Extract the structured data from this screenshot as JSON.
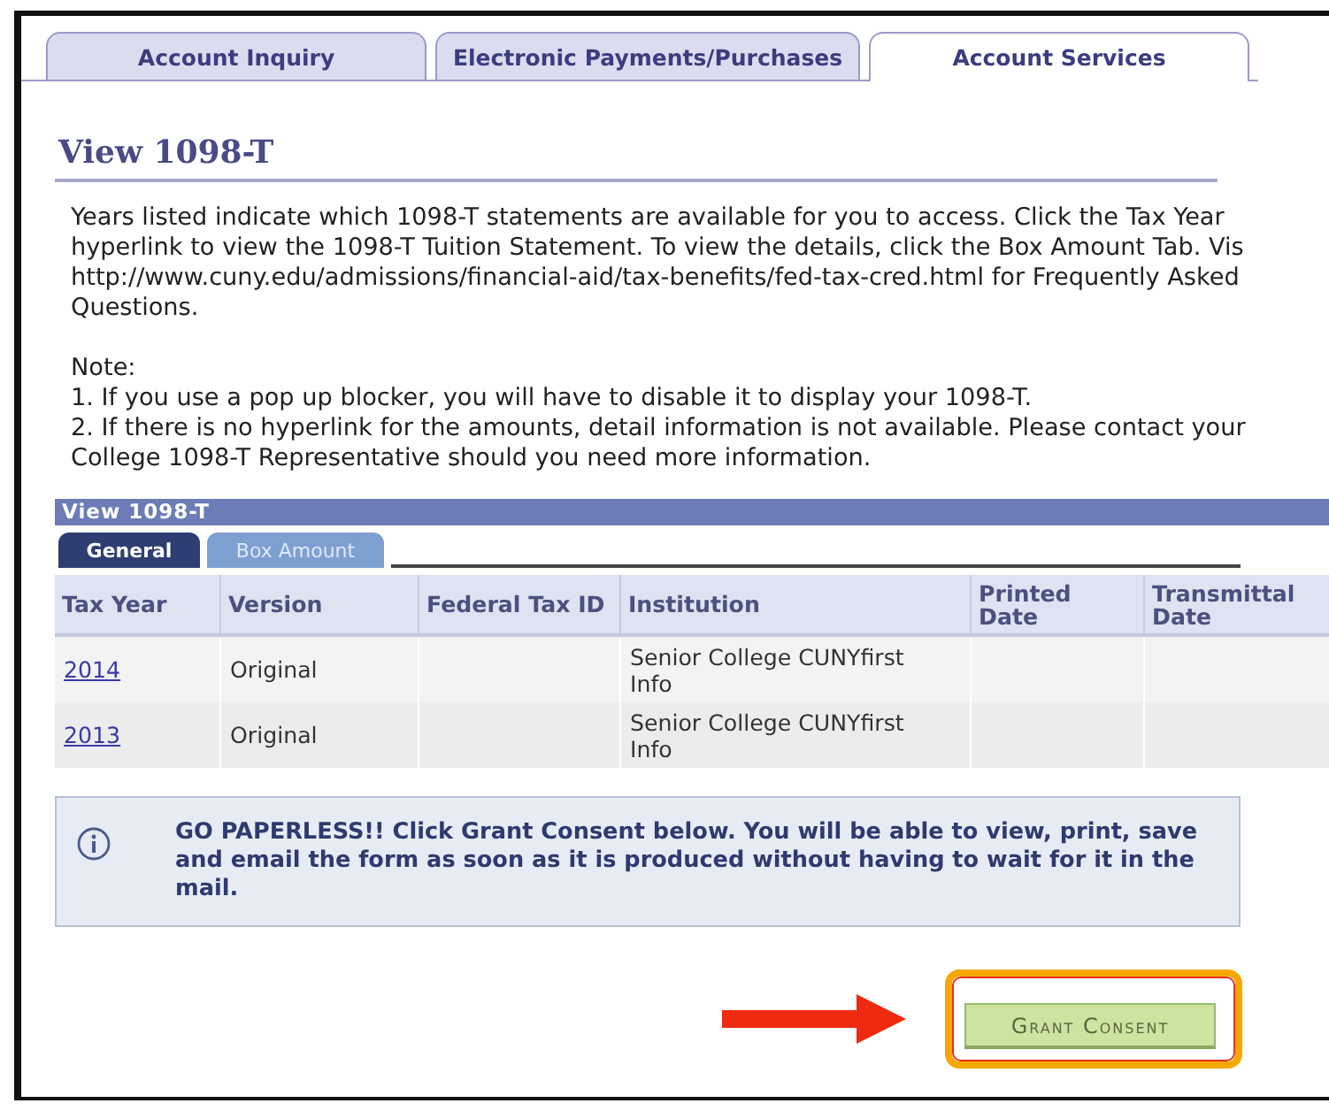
{
  "tabs": [
    {
      "label": "Account Inquiry",
      "selected": false
    },
    {
      "label": "Electronic Payments/Purchases",
      "selected": false
    },
    {
      "label": "Account Services",
      "selected": true
    }
  ],
  "page_title": "View 1098-T",
  "description_lines": [
    "Years listed indicate which 1098-T statements are available for you to access. Click the Tax Year",
    "hyperlink to view the 1098-T Tuition Statement.  To view the details, click the Box Amount Tab.  Vis",
    "http://www.cuny.edu/admissions/financial-aid/tax-benefits/fed-tax-cred.html for Frequently Asked",
    "Questions."
  ],
  "note_lines": [
    "Note:",
    "1. If you use a pop up blocker, you will have to disable it to display your 1098-T.",
    "2. If there is no hyperlink for the amounts, detail information is not available.  Please contact your",
    "College 1098-T Representative should you need more information."
  ],
  "grid": {
    "title": "View 1098-T",
    "tabs": [
      {
        "label": "General",
        "selected": true
      },
      {
        "label": "Box Amount",
        "selected": false
      }
    ],
    "columns": [
      "Tax Year",
      "Version",
      "Federal Tax ID",
      "Institution",
      "Printed Date",
      "Transmittal Date"
    ],
    "rows": [
      {
        "tax_year": "2014",
        "version": "Original",
        "institution": "Senior College CUNYfirst Info"
      },
      {
        "tax_year": "2013",
        "version": "Original",
        "institution": "Senior College CUNYfirst Info"
      }
    ]
  },
  "info_message": "GO PAPERLESS!! Click Grant Consent below. You will be able to view, print, save and email the form as soon as it is produced without having to wait for it in the mail.",
  "buttons": [
    "Grant Consent"
  ]
}
